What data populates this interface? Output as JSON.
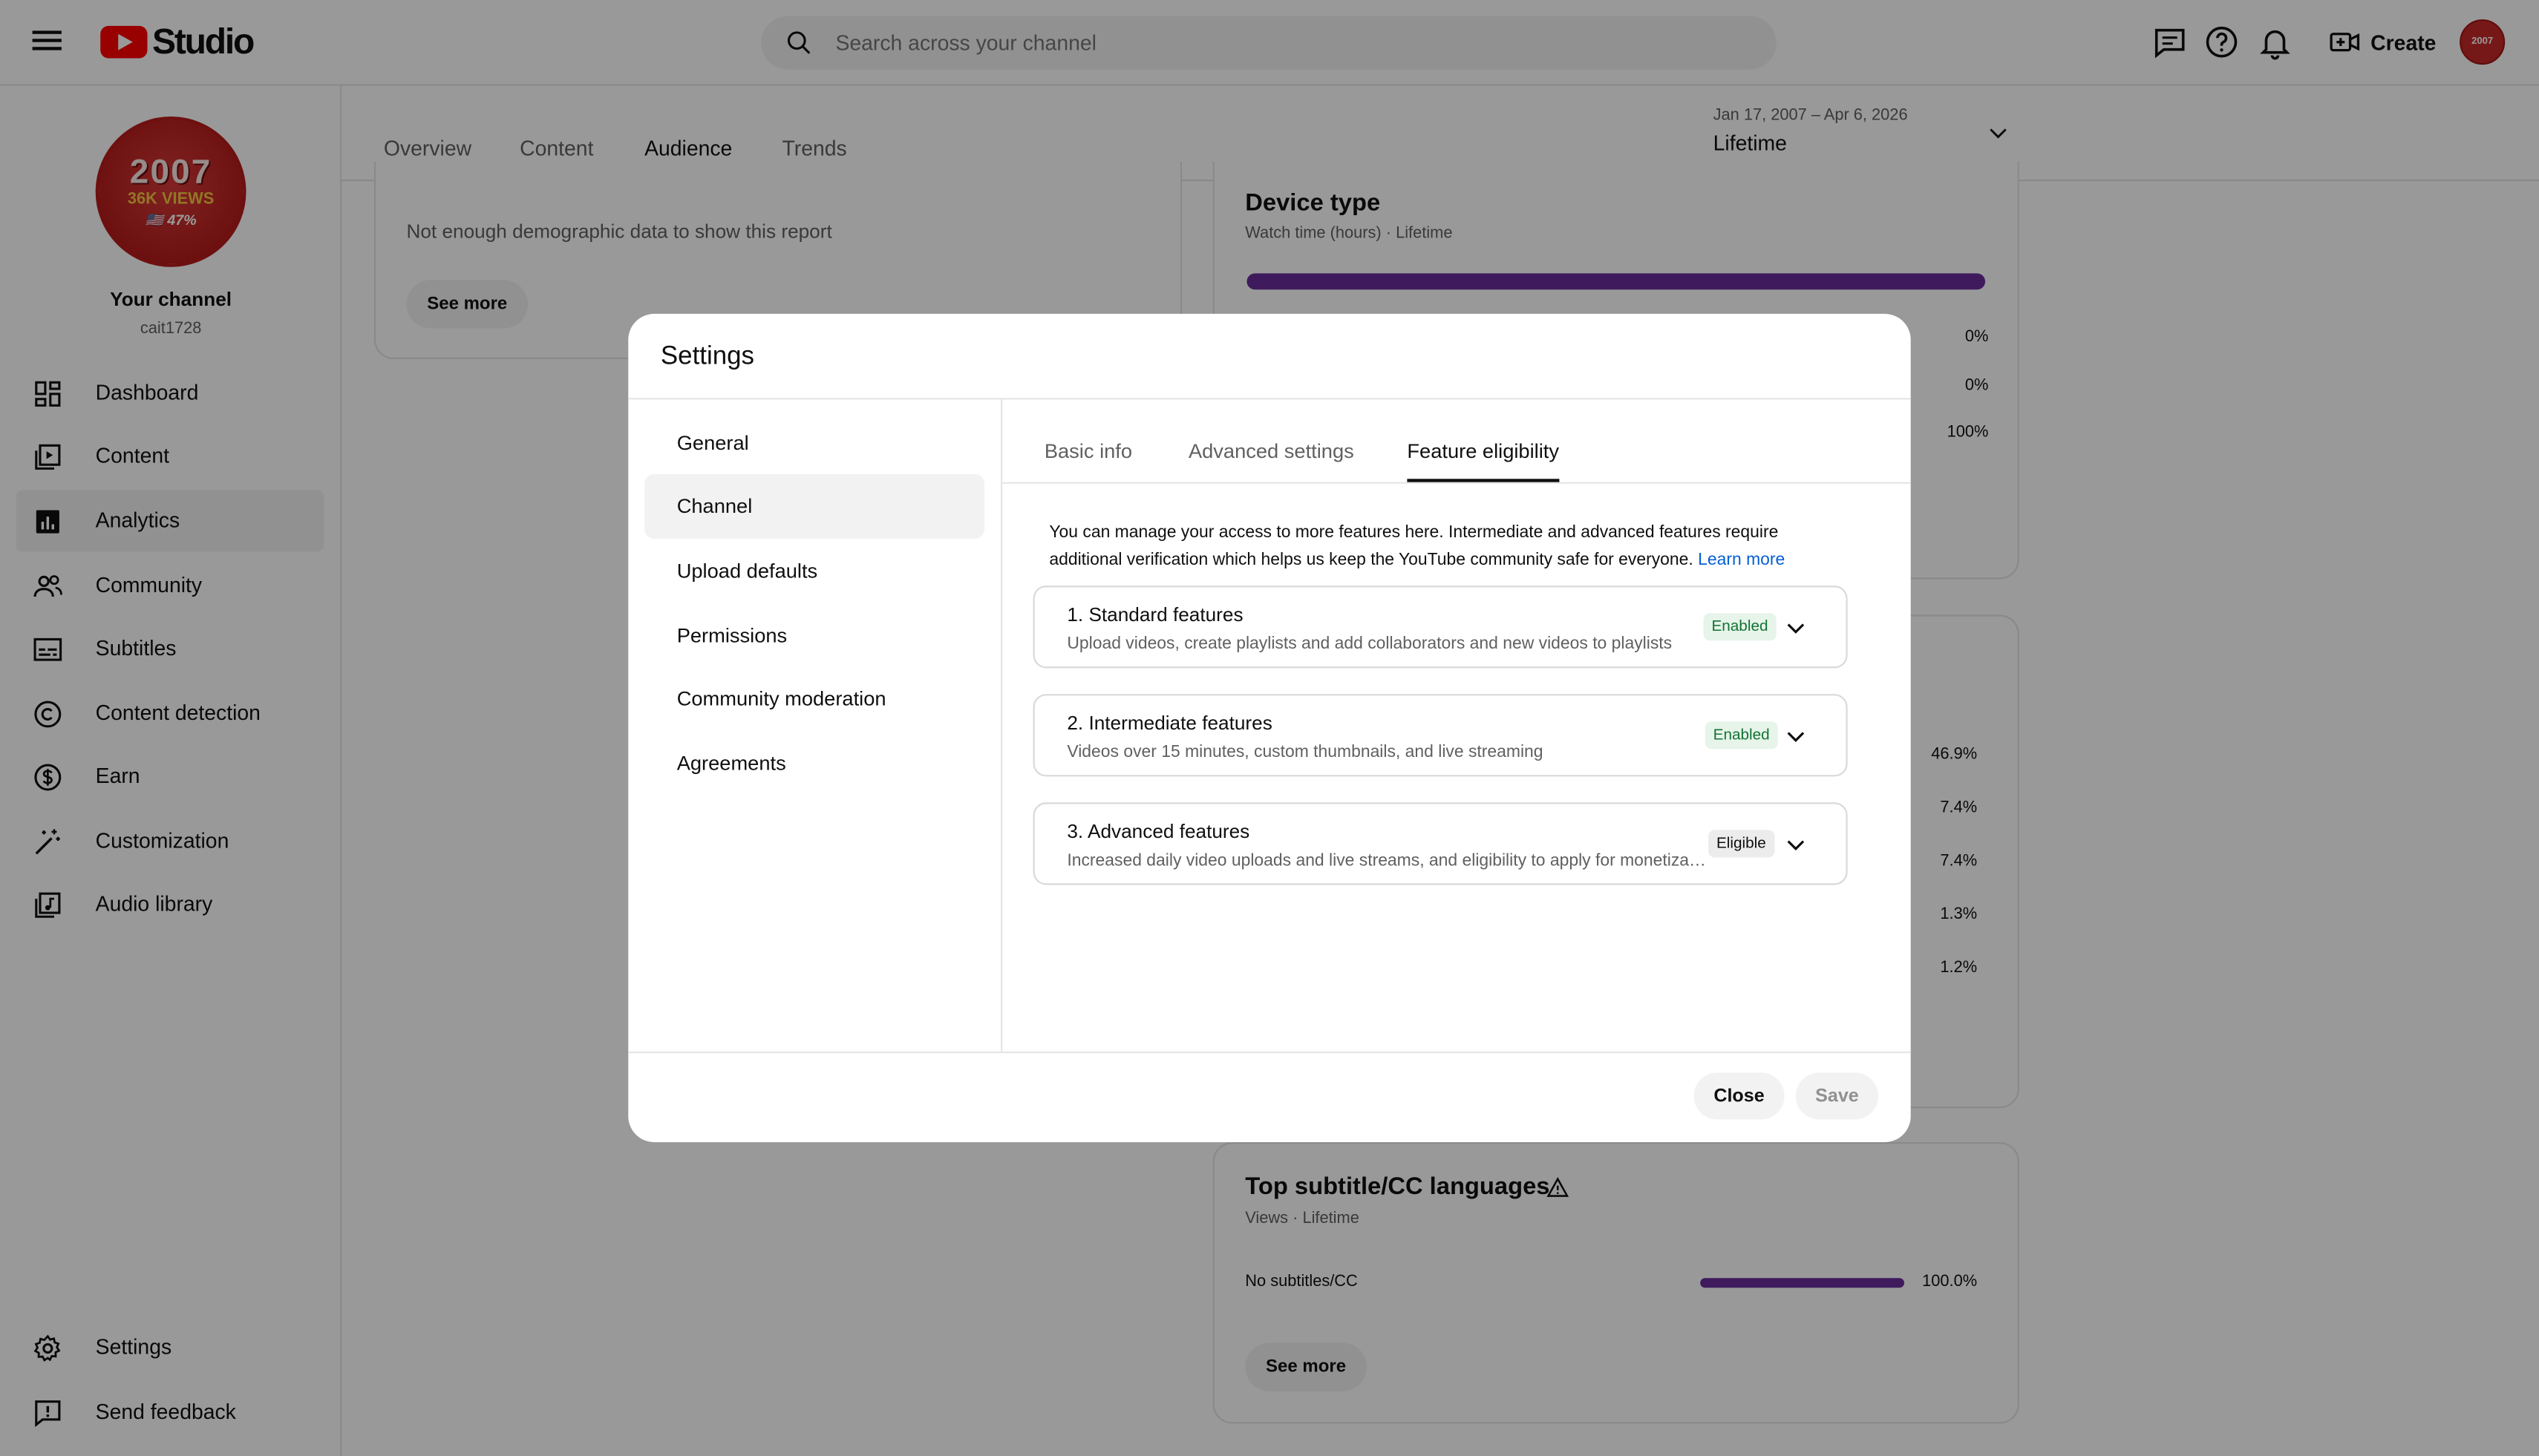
{
  "header": {
    "logo_text": "Studio",
    "search_placeholder": "Search across your channel",
    "create_label": "Create",
    "avatar_text": "2007"
  },
  "sidebar": {
    "avatar": {
      "year": "2007",
      "views": "36K VIEWS",
      "pct": "🇺🇸 47%"
    },
    "channel_name": "Your channel",
    "channel_handle": "cait1728",
    "items": [
      {
        "label": "Dashboard",
        "icon": "dashboard-icon"
      },
      {
        "label": "Content",
        "icon": "content-icon"
      },
      {
        "label": "Analytics",
        "icon": "analytics-icon",
        "active": true
      },
      {
        "label": "Community",
        "icon": "community-icon"
      },
      {
        "label": "Subtitles",
        "icon": "subtitles-icon"
      },
      {
        "label": "Content detection",
        "icon": "copyright-icon"
      },
      {
        "label": "Earn",
        "icon": "dollar-icon"
      },
      {
        "label": "Customization",
        "icon": "magic-wand-icon"
      },
      {
        "label": "Audio library",
        "icon": "audio-library-icon"
      }
    ],
    "bottom_items": [
      {
        "label": "Settings",
        "icon": "gear-icon"
      },
      {
        "label": "Send feedback",
        "icon": "feedback-icon"
      }
    ]
  },
  "main": {
    "tabs": [
      "Overview",
      "Content",
      "Audience",
      "Trends"
    ],
    "active_tab": "Audience",
    "date_range": "Jan 17, 2007 – Apr 6, 2026",
    "date_label": "Lifetime",
    "demographics_text": "Not enough demographic data to show this report",
    "see_more": "See more",
    "device_type": {
      "title": "Device type",
      "subtitle": "Watch time (hours) · Lifetime",
      "percents": [
        "0%",
        "0%",
        "100%"
      ]
    },
    "geo_percents": [
      "46.9%",
      "7.4%",
      "7.4%",
      "1.3%",
      "1.2%"
    ],
    "subtitles_card": {
      "title": "Top subtitle/CC languages",
      "subtitle": "Views · Lifetime",
      "row_label": "No subtitles/CC",
      "row_value": "100.0%",
      "row_fraction": 1.0,
      "see_more": "See more"
    },
    "accent_color": "#6a2e9b"
  },
  "dialog": {
    "title": "Settings",
    "nav": [
      "General",
      "Channel",
      "Upload defaults",
      "Permissions",
      "Community moderation",
      "Agreements"
    ],
    "active_nav": "Channel",
    "tabs": [
      "Basic info",
      "Advanced settings",
      "Feature eligibility"
    ],
    "active_tab": "Feature eligibility",
    "description": "You can manage your access to more features here. Intermediate and advanced features require additional verification which helps us keep the YouTube community safe for everyone.",
    "learn_more": "Learn more",
    "features": [
      {
        "title": "1. Standard features",
        "desc": "Upload videos, create playlists and add collaborators and new videos to playlists",
        "status": "Enabled"
      },
      {
        "title": "2. Intermediate features",
        "desc": "Videos over 15 minutes, custom thumbnails, and live streaming",
        "status": "Enabled"
      },
      {
        "title": "3. Advanced features",
        "desc": "Increased daily video uploads and live streams, and eligibility to apply for monetization",
        "status": "Eligible"
      }
    ],
    "close_label": "Close",
    "save_label": "Save"
  }
}
